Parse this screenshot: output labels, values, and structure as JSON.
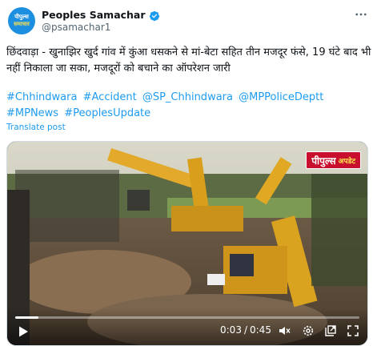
{
  "account": {
    "display_name": "Peoples Samachar",
    "handle": "@psamachar1",
    "avatar_line1": "पीपुल्स",
    "avatar_line2": "समाचार"
  },
  "tweet": {
    "text": "छिंदवाड़ा - खुनाझिर खुर्द गांव में कुंआ धसकने से मां-बेटा सहित तीन मजदूर फंसे, 19 घंटे बाद भी नहीं निकाला जा सका, मजदूरों को बचाने का ऑपरेशन जारी",
    "hashtags": [
      "#Chhindwara",
      "#Accident",
      "@SP_Chhindwara",
      "@MPPoliceDeptt",
      "#MPNews",
      "#PeoplesUpdate"
    ],
    "translate_label": "Translate post"
  },
  "video": {
    "brand_main": "पीपुल्स",
    "brand_sub": "अपडेट",
    "current_time": "0:03",
    "separator": "/",
    "duration": "0:45",
    "progress_fraction": 0.067
  },
  "icons": {
    "verified": "verified-badge-icon",
    "more": "more-options-icon",
    "play": "play-icon",
    "mute": "mute-icon",
    "settings": "settings-icon",
    "popout": "popout-icon",
    "fullscreen": "fullscreen-icon"
  },
  "colors": {
    "link": "#1d9bf0",
    "brand_red": "#c8102e",
    "avatar_blue": "#1d8fe0"
  }
}
